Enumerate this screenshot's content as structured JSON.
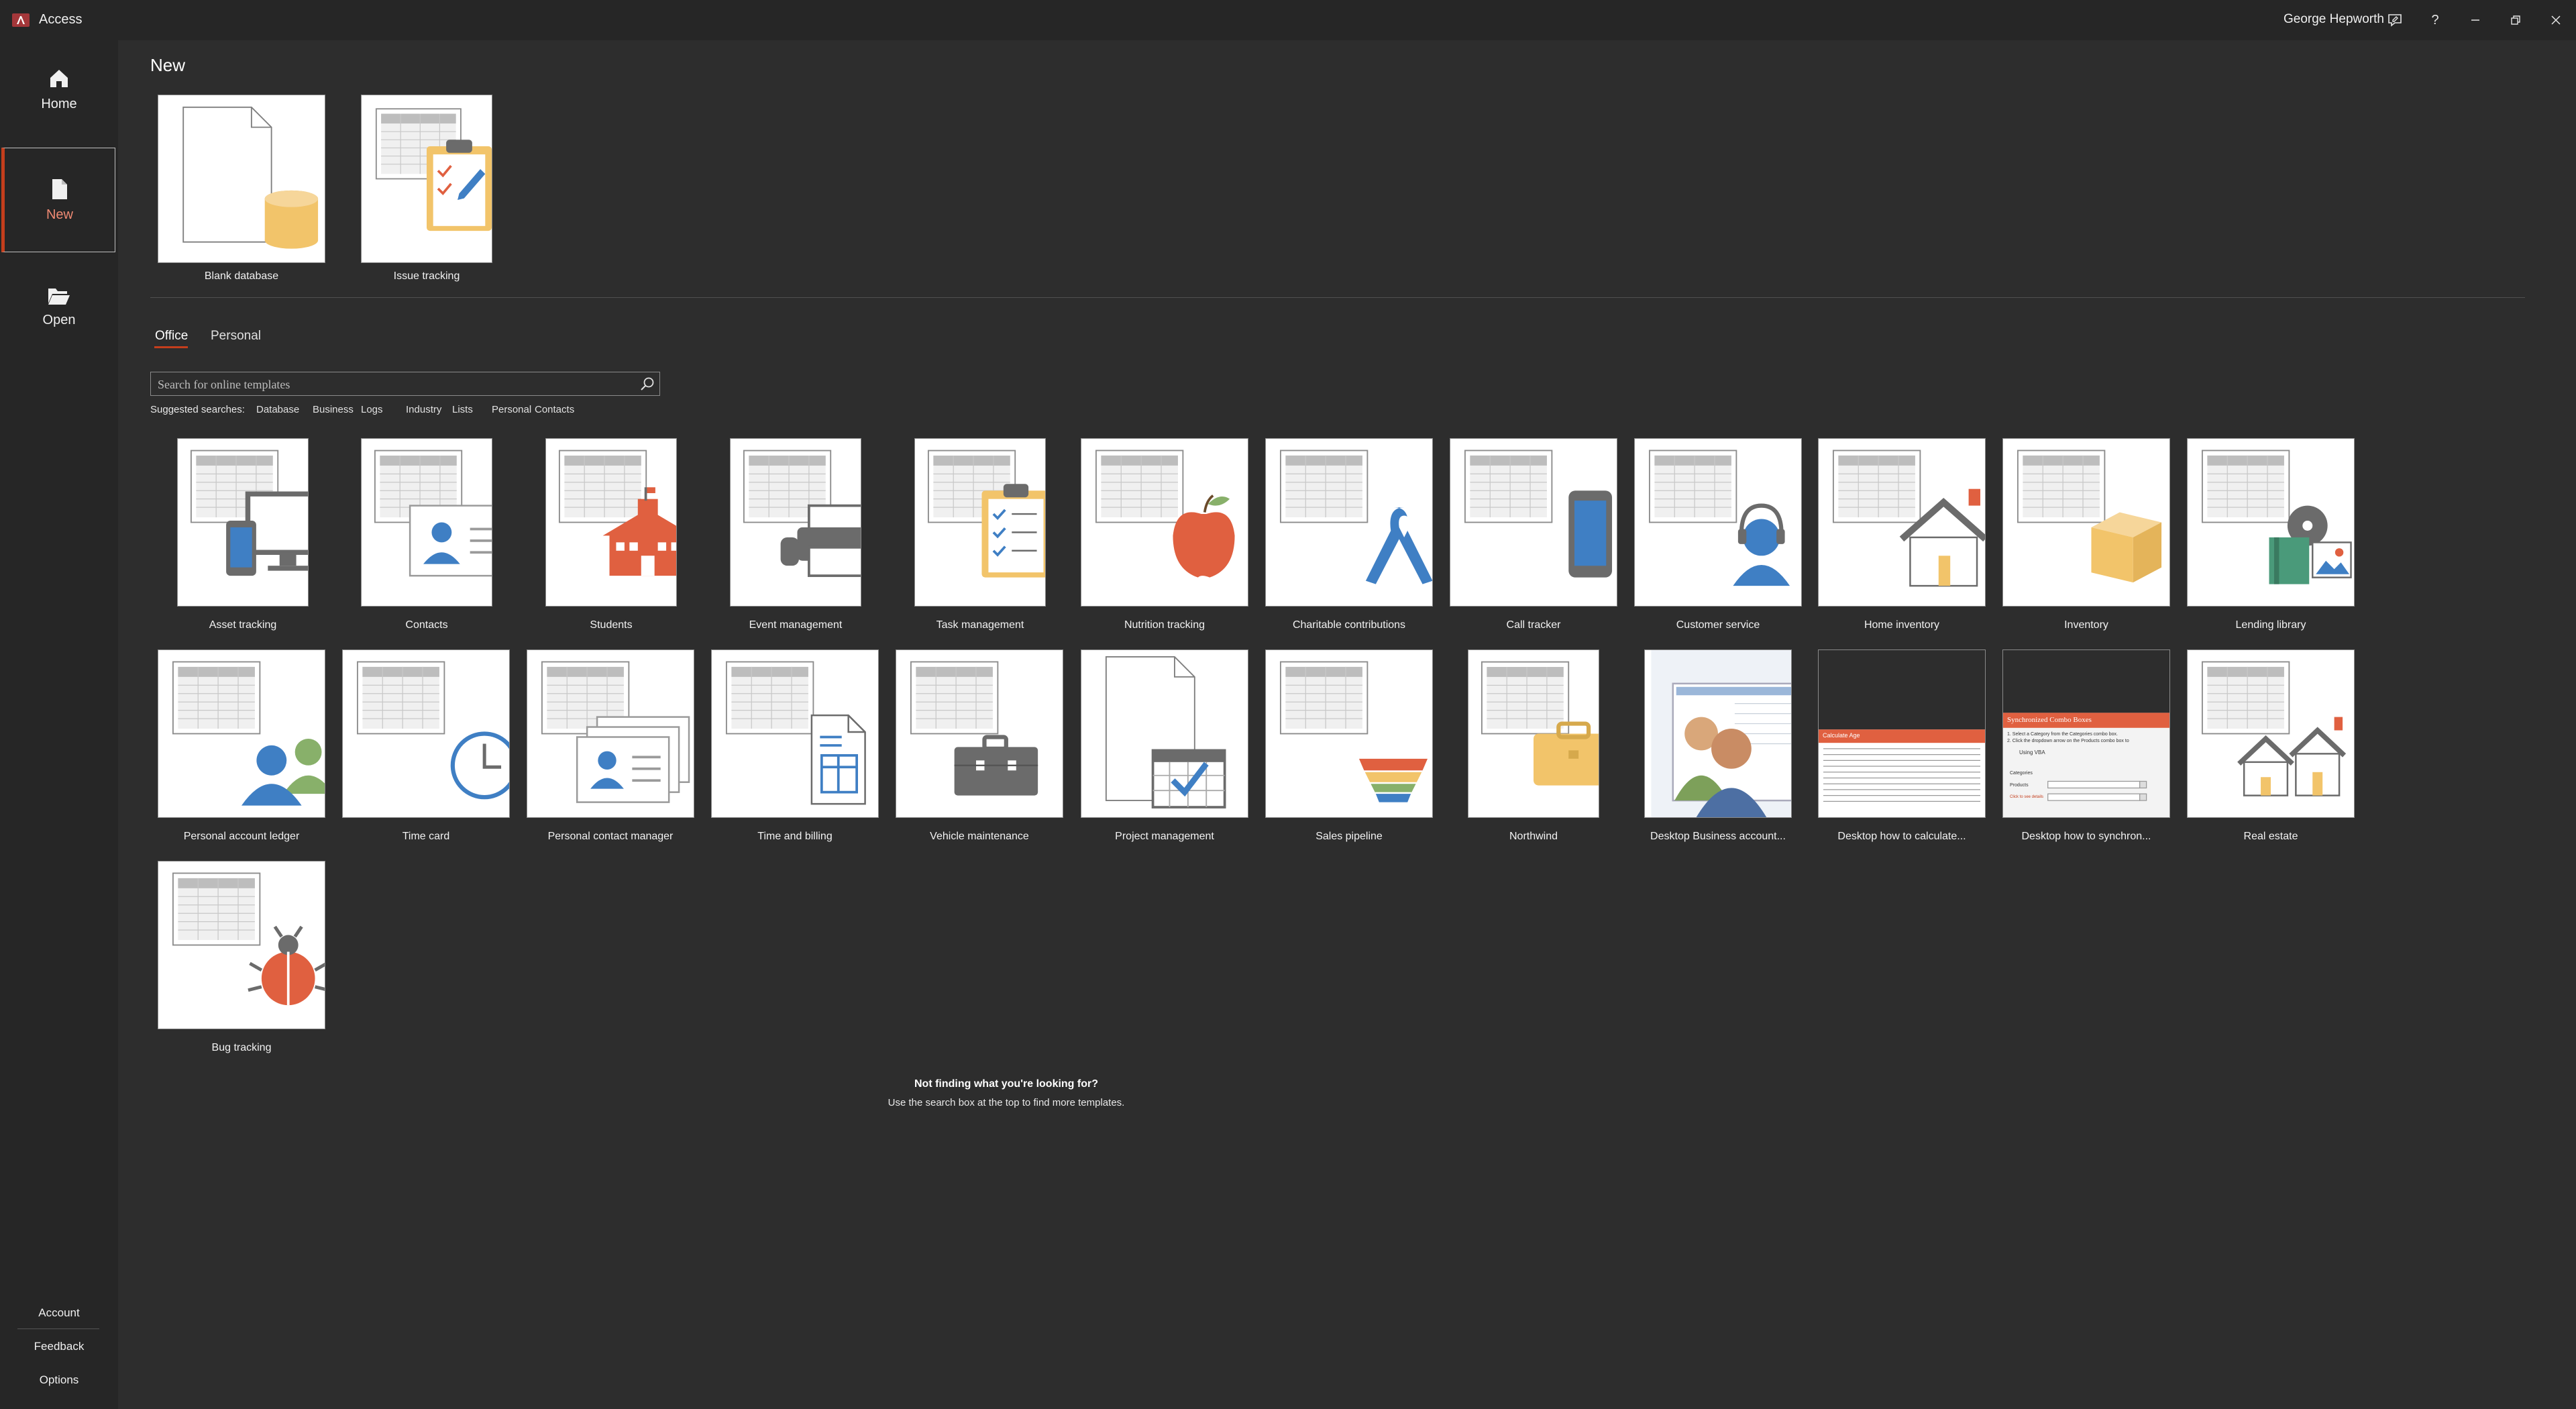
{
  "app": {
    "title": "Access",
    "user": "George Hepworth"
  },
  "colors": {
    "accent": "#c43e1c",
    "background": "#2d2d2d",
    "sidebar": "#262626"
  },
  "titlebar_icons": [
    "coauthor-icon",
    "help-icon",
    "minimize-icon",
    "restore-icon",
    "close-icon"
  ],
  "nav": {
    "home": "Home",
    "new": "New",
    "open": "Open",
    "account": "Account",
    "feedback": "Feedback",
    "options": "Options"
  },
  "page": {
    "heading": "New"
  },
  "featured": [
    {
      "label": "Blank database",
      "icon": "blank-database"
    },
    {
      "label": "Issue tracking",
      "icon": "issue-tracking"
    }
  ],
  "tabs": {
    "office": "Office",
    "personal": "Personal"
  },
  "search": {
    "placeholder": "Search for online templates"
  },
  "suggested": {
    "label": "Suggested searches:",
    "items": [
      "Database",
      "Business",
      "Logs",
      "Industry",
      "Lists",
      "Personal",
      "Contacts"
    ]
  },
  "templates": [
    {
      "label": "Asset tracking",
      "icon": "devices"
    },
    {
      "label": "Contacts",
      "icon": "contact-card"
    },
    {
      "label": "Students",
      "icon": "school"
    },
    {
      "label": "Event management",
      "icon": "printer"
    },
    {
      "label": "Task management",
      "icon": "clipboard"
    },
    {
      "label": "Nutrition tracking",
      "icon": "apple"
    },
    {
      "label": "Charitable contributions",
      "icon": "ribbon"
    },
    {
      "label": "Call tracker",
      "icon": "phone"
    },
    {
      "label": "Customer service",
      "icon": "headset"
    },
    {
      "label": "Home inventory",
      "icon": "house"
    },
    {
      "label": "Inventory",
      "icon": "box"
    },
    {
      "label": "Lending library",
      "icon": "media"
    },
    {
      "label": "Personal account ledger",
      "icon": "people"
    },
    {
      "label": "Time card",
      "icon": "clock"
    },
    {
      "label": "Personal contact manager",
      "icon": "contact-stack"
    },
    {
      "label": "Time and billing",
      "icon": "document"
    },
    {
      "label": "Vehicle maintenance",
      "icon": "toolbox"
    },
    {
      "label": "Project management",
      "icon": "calendar"
    },
    {
      "label": "Sales pipeline",
      "icon": "funnel"
    },
    {
      "label": "Northwind",
      "icon": "briefcase"
    },
    {
      "label": "Desktop Business account...",
      "icon": "business-people"
    },
    {
      "label": "Desktop how to calculate...",
      "icon": "calc-screenshot"
    },
    {
      "label": "Desktop how to synchron...",
      "icon": "sync-screenshot"
    },
    {
      "label": "Real estate",
      "icon": "houses"
    },
    {
      "label": "Bug tracking",
      "icon": "bug"
    }
  ],
  "thumb_text": {
    "calc_title": "Calculate Age",
    "sync_title": "Synchronized Combo Boxes",
    "sync_line1": "1. Select a Category from the Categories combo box.",
    "sync_line2": "2. Click the dropdown arrow on the Products combo box to",
    "sync_vba": "Using VBA",
    "sync_categories": "Categories",
    "sync_products": "Products",
    "sync_link": "Click to see details"
  },
  "footer": {
    "title": "Not finding what you're looking for?",
    "hint": "Use the search box at the top to find more templates."
  }
}
